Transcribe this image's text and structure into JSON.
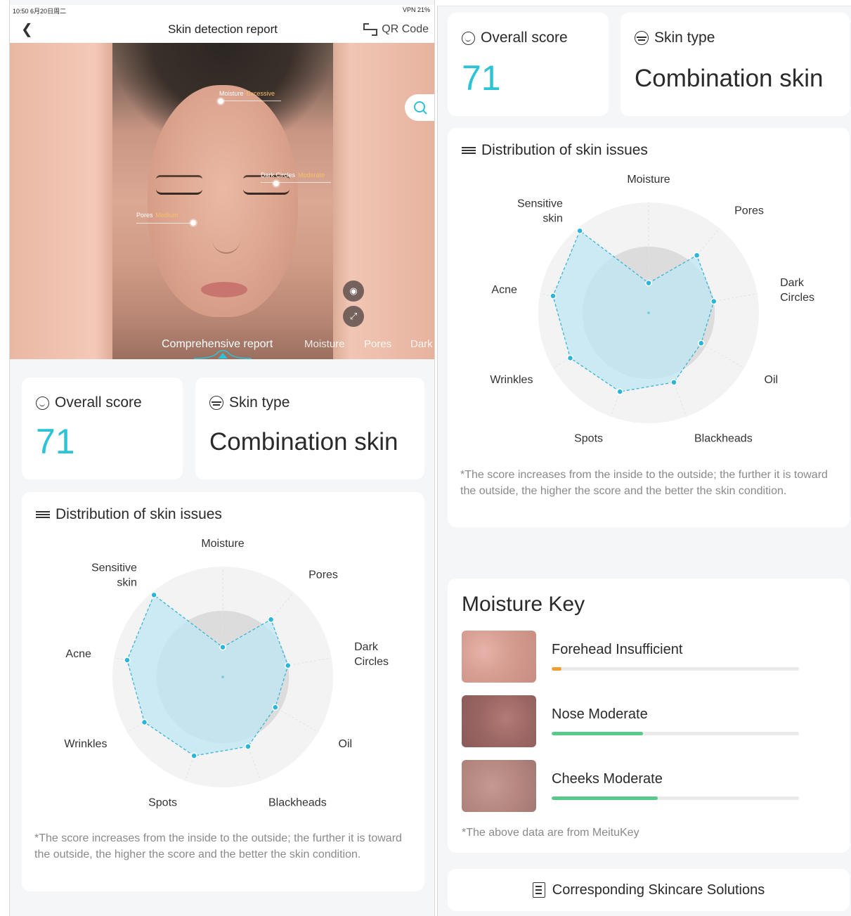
{
  "status_bar": {
    "time": "10:50",
    "date": "6月20日周二",
    "right": "VPN  21%"
  },
  "nav": {
    "title": "Skin detection report",
    "qr_label": "QR Code"
  },
  "photo": {
    "highlights": [
      {
        "name": "Moisture",
        "level": "Excessive"
      },
      {
        "name": "Dark Circles",
        "level": "Moderate"
      },
      {
        "name": "Pores",
        "level": "Medium"
      }
    ],
    "tabs": [
      "Comprehensive report",
      "Moisture",
      "Pores",
      "Dark"
    ]
  },
  "overall": {
    "title": "Overall score",
    "score": "71"
  },
  "skin_type": {
    "title": "Skin type",
    "value": "Combination skin"
  },
  "distribution": {
    "title": "Distribution of skin issues",
    "footnote": "*The score increases from the inside to the outside; the further it is toward the outside, the higher the score and the better the skin condition."
  },
  "chart_data": {
    "type": "radar",
    "categories": [
      "Moisture",
      "Pores",
      "Dark Circles",
      "Oil",
      "Blackheads",
      "Spots",
      "Wrinkles",
      "Acne",
      "Sensitive skin"
    ],
    "category_lines": [
      [
        "Moisture"
      ],
      [
        "Pores"
      ],
      [
        "Dark",
        "Circles"
      ],
      [
        "Oil"
      ],
      [
        "Blackheads"
      ],
      [
        "Spots"
      ],
      [
        "Wrinkles"
      ],
      [
        "Acne"
      ],
      [
        "Sensitive",
        "skin"
      ]
    ],
    "values": [
      0.27,
      0.68,
      0.6,
      0.55,
      0.67,
      0.76,
      0.82,
      0.88,
      0.97
    ],
    "range": [
      0,
      1
    ],
    "average_level": 0.6,
    "colors": {
      "fill": "#bfe7f3",
      "stroke": "#38b4da",
      "dot": "#29b6d8",
      "average": "#dcdcdc",
      "outer": "#f3f3f3"
    }
  },
  "moisture_key": {
    "title": "Moisture Key",
    "items": [
      {
        "label": "Forehead Insufficient",
        "level": 0.04,
        "color": "#f0a030"
      },
      {
        "label": "Nose Moderate",
        "level": 0.37,
        "color": "#57c98a"
      },
      {
        "label": "Cheeks Moderate",
        "level": 0.43,
        "color": "#57c98a"
      }
    ],
    "footnote": "*The above data are from MeituKey"
  },
  "solutions_label": "Corresponding Skincare Solutions",
  "colors": {
    "accent": "#2bc3d6"
  }
}
